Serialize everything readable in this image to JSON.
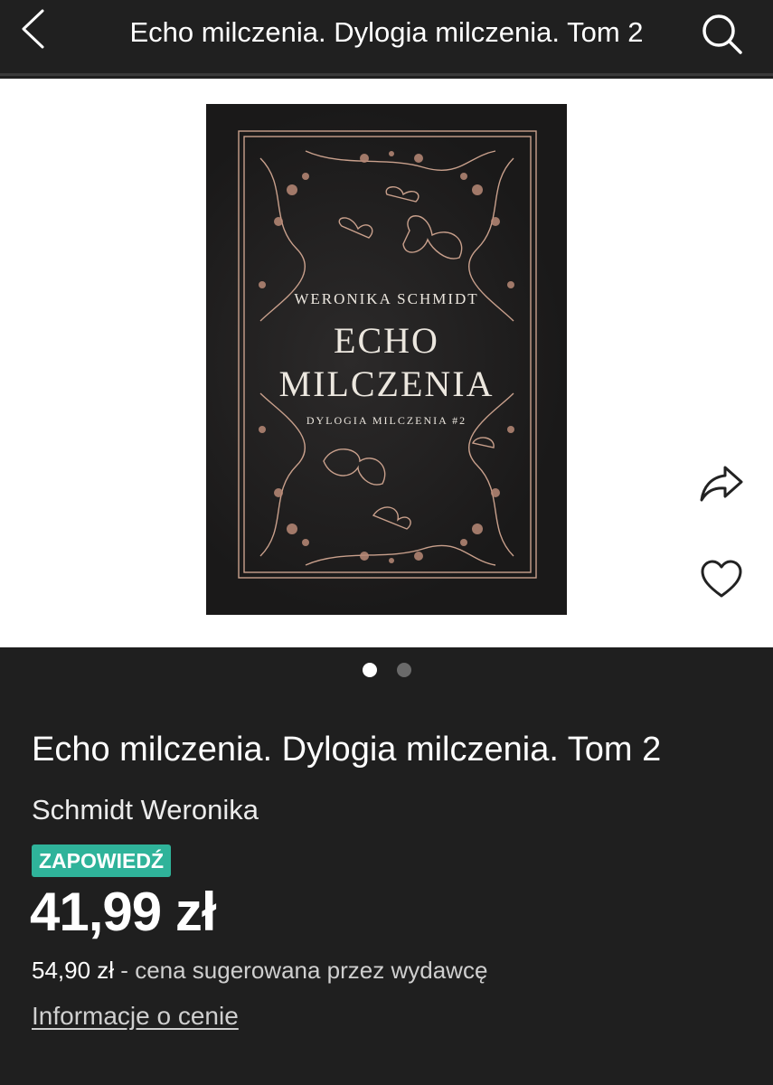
{
  "header": {
    "title": "Echo milczenia. Dylogia milczenia. Tom 2",
    "back_icon": "chevron-left-icon",
    "search_icon": "search-icon"
  },
  "gallery": {
    "cover": {
      "author": "WERONIKA SCHMIDT",
      "title_line1": "ECHO",
      "title_line2": "MILCZENIA",
      "series": "DYLOGIA MILCZENIA #2"
    },
    "share_icon": "share-icon",
    "favorite_icon": "heart-icon",
    "pages": 2,
    "active_page": 1
  },
  "product": {
    "title": "Echo milczenia. Dylogia milczenia. Tom 2",
    "author": "Schmidt Weronika",
    "badge": "ZAPOWIEDŹ",
    "price": "41,99 zł",
    "suggested_price": "54,90 zł",
    "suggested_separator": " - ",
    "suggested_note": "cena sugerowana przez wydawcę",
    "price_info_link": "Informacje o cenie"
  },
  "colors": {
    "background": "#1f1f1f",
    "badge": "#2fb39a",
    "cover": "#1c1b1b",
    "ornament": "#c9a08c"
  }
}
